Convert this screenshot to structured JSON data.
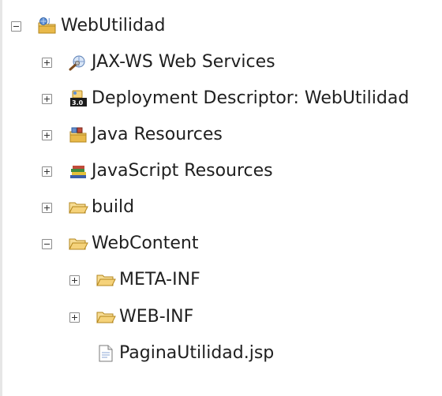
{
  "tree": {
    "project": {
      "label": "WebUtilidad",
      "icon": "web-project-icon",
      "state": "expanded"
    },
    "items": [
      {
        "label": "JAX-WS Web Services",
        "icon": "web-services-icon",
        "state": "collapsed"
      },
      {
        "label": "Deployment Descriptor: WebUtilidad",
        "icon": "deployment-descriptor-icon",
        "state": "collapsed"
      },
      {
        "label": "Java Resources",
        "icon": "java-resources-icon",
        "state": "collapsed"
      },
      {
        "label": "JavaScript Resources",
        "icon": "javascript-resources-icon",
        "state": "collapsed"
      },
      {
        "label": "build",
        "icon": "folder-icon",
        "state": "collapsed"
      },
      {
        "label": "WebContent",
        "icon": "folder-icon",
        "state": "expanded"
      }
    ],
    "webcontent_children": [
      {
        "label": "META-INF",
        "icon": "folder-icon",
        "state": "collapsed"
      },
      {
        "label": "WEB-INF",
        "icon": "folder-icon",
        "state": "collapsed"
      },
      {
        "label": "PaginaUtilidad.jsp",
        "icon": "jsp-file-icon"
      }
    ]
  },
  "colors": {
    "folder_fill": "#f5d27a",
    "folder_stroke": "#b3861c",
    "text": "#1f1f1f",
    "toggle_border": "#8c8c8c"
  }
}
